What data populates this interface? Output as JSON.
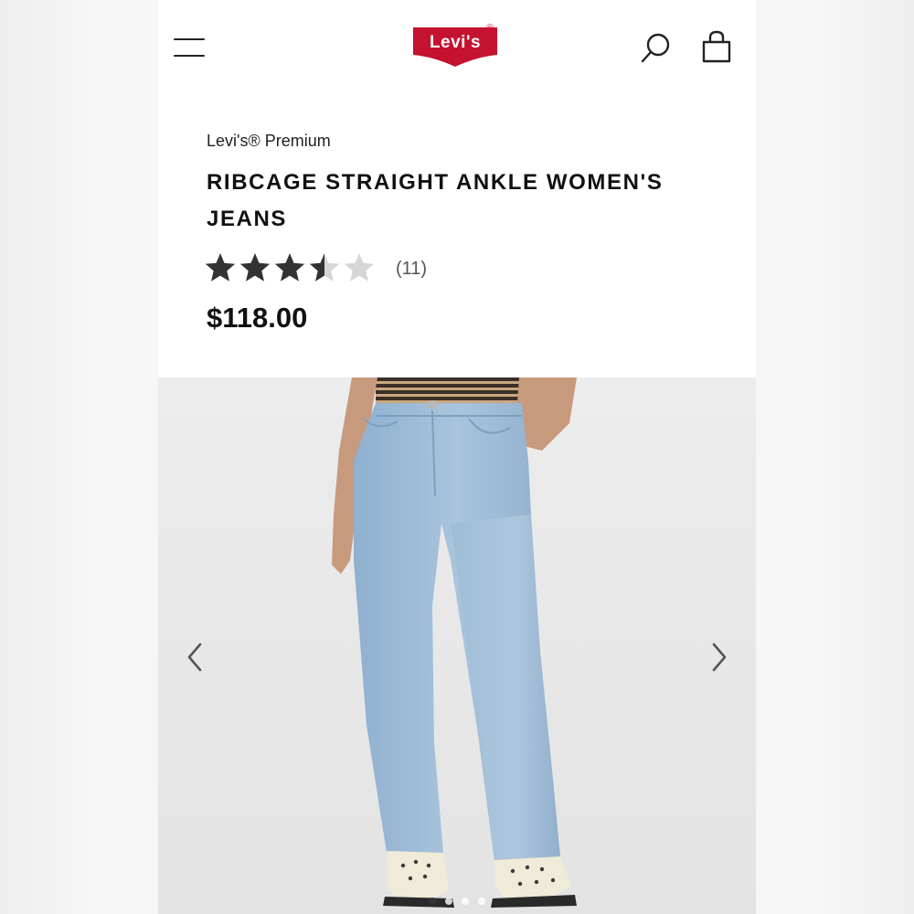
{
  "header": {
    "logo_text": "Levi's",
    "logo_reg": "®",
    "brand_color": "#c41230",
    "icons": [
      "menu-icon",
      "search-icon",
      "shopping-bag-icon"
    ]
  },
  "product": {
    "brand": "Levi's® Premium",
    "title": "RIBCAGE STRAIGHT ANKLE WOMEN'S JEANS",
    "rating": 3.5,
    "rating_max": 5,
    "review_count": "(11)",
    "price": "$118.00"
  },
  "gallery": {
    "image_description_icon": "jeans-product-photo",
    "prev_icon": "chevron-left-icon",
    "next_icon": "chevron-right-icon",
    "dot_count": 4,
    "active_dot": 0
  }
}
